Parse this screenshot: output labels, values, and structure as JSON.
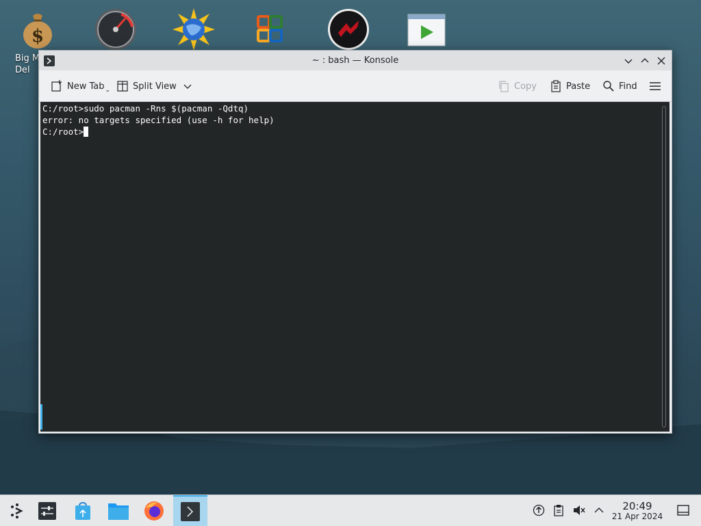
{
  "desktop": {
    "icons": [
      {
        "name": "money-bag-icon",
        "label": "Big M\nDel"
      },
      {
        "name": "speedometer-icon"
      },
      {
        "name": "sun-globe-icon"
      },
      {
        "name": "office-puzzle-icon"
      },
      {
        "name": "red-dark-disc-icon"
      },
      {
        "name": "video-player-icon"
      }
    ]
  },
  "window": {
    "title": "~ : bash — Konsole",
    "toolbar": {
      "new_tab": "New Tab",
      "split_view": "Split View",
      "copy": "Copy",
      "paste": "Paste",
      "find": "Find"
    },
    "terminal": {
      "lines": [
        "C:/root>sudo pacman -Rns $(pacman -Qdtq)",
        "error: no targets specified (use -h for help)",
        "C:/root>"
      ]
    }
  },
  "taskbar": {
    "apps": [
      "application-launcher",
      "system-settings",
      "discover",
      "dolphin",
      "firefox",
      "konsole"
    ],
    "active_app": "konsole",
    "clock": {
      "time": "20:49",
      "date": "21 Apr 2024"
    }
  },
  "colors": {
    "accent": "#3daee9",
    "terminal_bg": "#232627",
    "terminal_fg": "#fcfcfc"
  }
}
